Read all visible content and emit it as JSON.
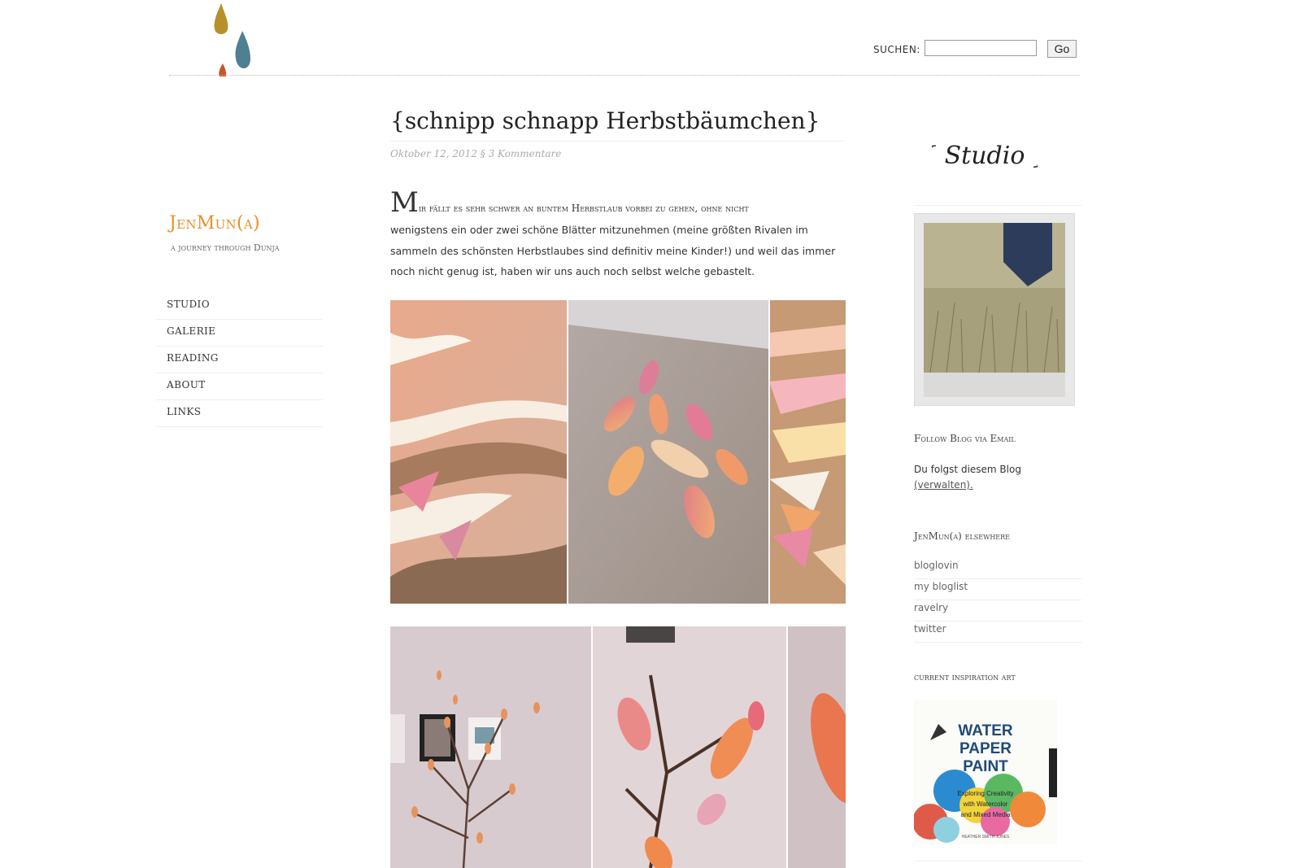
{
  "header": {
    "search_label": "SUCHEN:",
    "search_value": "",
    "search_button": "Go",
    "logo_icon": "paint-drops-icon"
  },
  "sidebar_left": {
    "site_title": "JenMun(a)",
    "tagline": "a journey through Dunja",
    "nav": [
      {
        "label": "STUDIO"
      },
      {
        "label": "GALERIE"
      },
      {
        "label": "READING"
      },
      {
        "label": "ABOUT"
      },
      {
        "label": "LINKS"
      }
    ]
  },
  "post": {
    "title": "{schnipp schnapp Herbstbäumchen}",
    "date": "Oktober 12, 2012",
    "meta_separator": "§",
    "comments": "3 Kommentare",
    "intro_dropcap": "M",
    "intro_rest": "ir fällt es sehr schwer an buntem Herbstlaub vorbei zu gehen, ohne nicht",
    "body": "wenigstens ein oder zwei schöne Blätter mitzunehmen (meine größten Rivalen im sammeln des schönsten Herbstlaubes sind definitiv meine Kinder!) und weil das immer noch nicht genug ist, haben wir uns auch noch selbst welche gebastelt."
  },
  "sidebar_right": {
    "studio_logo": "{ Studio }",
    "follow_title": "Follow Blog via Email",
    "follow_text": "Du folgst diesem Blog",
    "follow_manage": "(verwalten).",
    "elsewhere_title": "JenMun(a) elsewhere",
    "elsewhere_links": [
      {
        "label": "bloglovin"
      },
      {
        "label": "my bloglist"
      },
      {
        "label": "ravelry"
      },
      {
        "label": "twitter"
      }
    ],
    "inspiration_title": "current inspiration art",
    "book": {
      "line1": "WATER",
      "line2": "PAPER",
      "line3": "PAINT",
      "subtitle1": "Exploring Creativity",
      "subtitle2": "with Watercolor",
      "subtitle3": "and Mixed Media",
      "author": "HEATHER SMITH JONES"
    }
  },
  "colors": {
    "accent_orange": "#e8902a",
    "text": "#333333",
    "meta_grey": "#aaaaaa"
  }
}
